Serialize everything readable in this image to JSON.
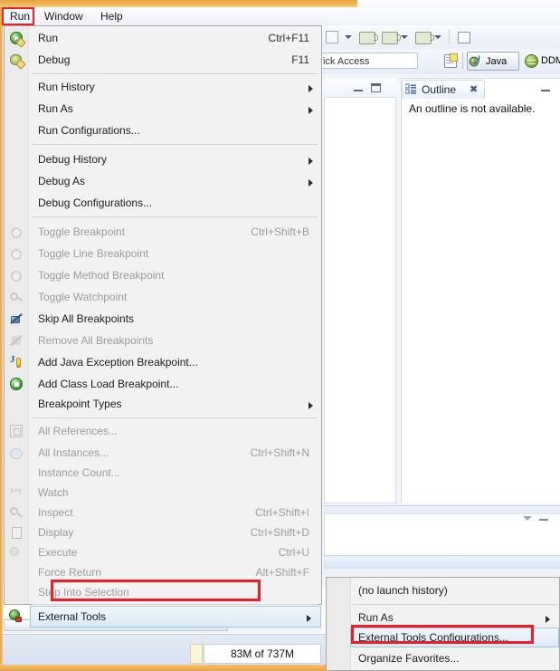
{
  "window": {
    "menubar": [
      {
        "label": "Run",
        "highlighted": true
      },
      {
        "label": "Window",
        "highlighted": false
      },
      {
        "label": "Help",
        "highlighted": false
      }
    ],
    "quick_access_placeholder": "ick Access",
    "perspectives": [
      {
        "label": "Java",
        "active": true
      },
      {
        "label": "DDM",
        "active": false
      }
    ]
  },
  "outline_view": {
    "tab_label": "Outline",
    "empty_text": "An outline is not available."
  },
  "status_bar": {
    "heap_text": "83M of 737M"
  },
  "scrollbar": {
    "thumb_glyph": "III"
  },
  "run_menu": {
    "items": [
      {
        "label": "Run",
        "accel": "Ctrl+F11",
        "icon": "run-icon",
        "disabled": false,
        "submenu": false
      },
      {
        "label": "Debug",
        "accel": "F11",
        "icon": "debug-icon",
        "disabled": false,
        "submenu": false
      },
      {
        "separator": true
      },
      {
        "label": "Run History",
        "accel": "",
        "icon": "",
        "disabled": false,
        "submenu": true
      },
      {
        "label": "Run As",
        "accel": "",
        "icon": "",
        "disabled": false,
        "submenu": true
      },
      {
        "label": "Run Configurations...",
        "accel": "",
        "icon": "",
        "disabled": false,
        "submenu": false
      },
      {
        "separator": true
      },
      {
        "label": "Debug History",
        "accel": "",
        "icon": "",
        "disabled": false,
        "submenu": true
      },
      {
        "label": "Debug As",
        "accel": "",
        "icon": "",
        "disabled": false,
        "submenu": true
      },
      {
        "label": "Debug Configurations...",
        "accel": "",
        "icon": "",
        "disabled": false,
        "submenu": false
      },
      {
        "separator": true
      },
      {
        "label": "Toggle Breakpoint",
        "accel": "Ctrl+Shift+B",
        "icon": "breakpoint-icon",
        "disabled": true,
        "submenu": false
      },
      {
        "label": "Toggle Line Breakpoint",
        "accel": "",
        "icon": "line-breakpoint-icon",
        "disabled": true,
        "submenu": false
      },
      {
        "label": "Toggle Method Breakpoint",
        "accel": "",
        "icon": "method-breakpoint-icon",
        "disabled": true,
        "submenu": false
      },
      {
        "label": "Toggle Watchpoint",
        "accel": "",
        "icon": "watchpoint-icon",
        "disabled": true,
        "submenu": false
      },
      {
        "label": "Skip All Breakpoints",
        "accel": "",
        "icon": "skip-breakpoints-icon",
        "disabled": false,
        "submenu": false
      },
      {
        "label": "Remove All Breakpoints",
        "accel": "",
        "icon": "remove-breakpoints-icon",
        "disabled": true,
        "submenu": false
      },
      {
        "label": "Add Java Exception Breakpoint...",
        "accel": "",
        "icon": "java-exception-icon",
        "disabled": false,
        "submenu": false
      },
      {
        "label": "Add Class Load Breakpoint...",
        "accel": "",
        "icon": "class-load-icon",
        "disabled": false,
        "submenu": false
      },
      {
        "label": "Breakpoint Types",
        "accel": "",
        "icon": "",
        "disabled": false,
        "submenu": true
      },
      {
        "separator": true
      },
      {
        "label": "All References...",
        "accel": "",
        "icon": "all-references-icon",
        "disabled": true,
        "submenu": false
      },
      {
        "label": "All Instances...",
        "accel": "Ctrl+Shift+N",
        "icon": "all-instances-icon",
        "disabled": true,
        "submenu": false
      },
      {
        "label": "Instance Count...",
        "accel": "",
        "icon": "",
        "disabled": true,
        "submenu": false
      },
      {
        "label": "Watch",
        "accel": "",
        "icon": "watch-icon",
        "disabled": true,
        "submenu": false
      },
      {
        "label": "Inspect",
        "accel": "Ctrl+Shift+I",
        "icon": "inspect-icon",
        "disabled": true,
        "submenu": false
      },
      {
        "label": "Display",
        "accel": "Ctrl+Shift+D",
        "icon": "display-icon",
        "disabled": true,
        "submenu": false
      },
      {
        "label": "Execute",
        "accel": "Ctrl+U",
        "icon": "execute-icon",
        "disabled": true,
        "submenu": false
      },
      {
        "label": "Force Return",
        "accel": "Alt+Shift+F",
        "icon": "",
        "disabled": true,
        "submenu": false
      },
      {
        "label": "Step Into Selection",
        "accel": "",
        "icon": "",
        "disabled": true,
        "submenu": false
      },
      {
        "separator": true
      },
      {
        "label": "External Tools",
        "accel": "",
        "icon": "external-tools-icon",
        "disabled": false,
        "submenu": true,
        "selected": true,
        "highlighted": true
      }
    ]
  },
  "external_tools_submenu": {
    "items": [
      {
        "label": "(no launch history)",
        "disabled": true,
        "submenu": false
      },
      {
        "separator": true
      },
      {
        "label": "Run As",
        "disabled": false,
        "submenu": true
      },
      {
        "label": "External Tools Configurations...",
        "disabled": false,
        "submenu": false,
        "highlighted": true
      },
      {
        "label": "Organize Favorites...",
        "disabled": false,
        "submenu": false
      }
    ]
  },
  "colors": {
    "highlight_red": "#ee1c25",
    "menu_bg": "#f2f2f2",
    "gutter_bg": "#ebebeb",
    "title_orange": "#e8a33d"
  }
}
